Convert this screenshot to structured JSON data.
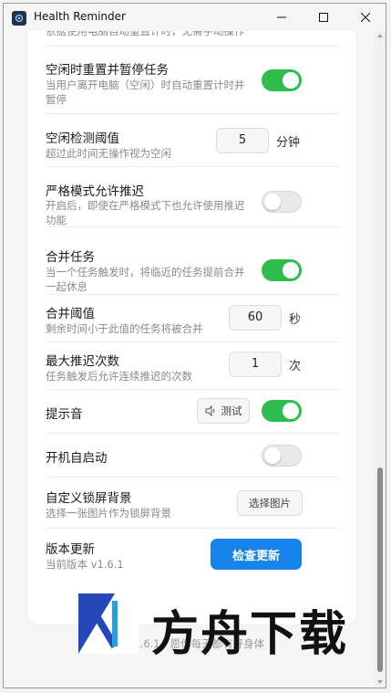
{
  "window": {
    "title": "Health Reminder",
    "app_icon": "app-logo-icon"
  },
  "settings": {
    "truncated_desc": "依据使用电脑自动重置计时，无需手动操作",
    "idle_reset": {
      "title": "空闲时重置并暂停任务",
      "desc_line1": "当用户离开电脑（空闲）时自动重置计时并",
      "desc_line2": "暂停",
      "on": true
    },
    "idle_threshold": {
      "title": "空闲检测阈值",
      "desc": "超过此时间无操作视为空闲",
      "value": "5",
      "unit": "分钟"
    },
    "strict_postpone": {
      "title": "严格模式允许推迟",
      "desc_line1": "开启后，即使在严格模式下也允许使用推迟",
      "desc_line2": "功能",
      "on": false
    },
    "merge_tasks": {
      "title": "合并任务",
      "desc_line1": "当一个任务触发时，将临近的任务提前合并",
      "desc_line2": "一起休息",
      "on": true
    },
    "merge_threshold": {
      "title": "合并阈值",
      "desc": "剩余时间小于此值的任务将被合并",
      "value": "60",
      "unit": "秒"
    },
    "max_postpone": {
      "title": "最大推迟次数",
      "desc": "任务触发后允许连续推迟的次数",
      "value": "1",
      "unit": "次"
    },
    "sound": {
      "title": "提示音",
      "test_label": "测试",
      "on": true
    },
    "autostart": {
      "title": "开机自启动",
      "on": false
    },
    "lock_bg": {
      "title": "自定义锁屏背景",
      "desc": "选择一张图片作为锁屏背景",
      "button": "选择图片"
    },
    "update": {
      "title": "版本更新",
      "version": "当前版本 v1.6.1",
      "button": "检查更新"
    }
  },
  "footer": {
    "text": "助手 v1.6.1 · 愿你每天都有好身体"
  },
  "watermark": {
    "text": "方舟下载"
  },
  "colors": {
    "toggle_on": "#2dbd4f",
    "primary": "#1683ea"
  }
}
